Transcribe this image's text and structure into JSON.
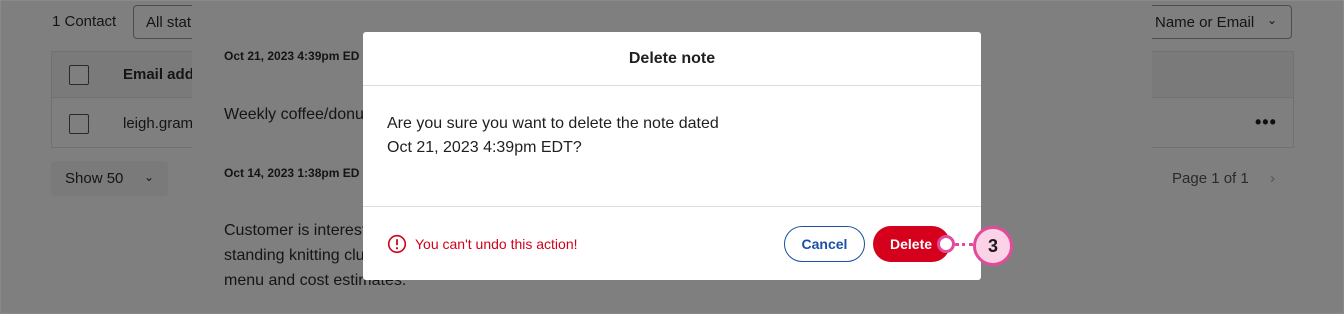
{
  "background": {
    "contact_count": "1 Contact",
    "status_filter": "All stat",
    "search_select": "Name or Email",
    "table": {
      "header_email": "Email addr",
      "row_email": "leigh.gram",
      "row_actions": "•••"
    },
    "show_select": "Show 50",
    "pagination": "Page 1 of 1"
  },
  "notes": [
    {
      "date": "Oct 21, 2023 4:39pm ED",
      "text": "Weekly coffee/donu"
    },
    {
      "date": "Oct 14, 2023 1:38pm ED",
      "text_lines": [
        "Customer is interest",
        "standing knitting clu",
        "menu and cost estimates."
      ]
    }
  ],
  "modal": {
    "title": "Delete note",
    "message_line1": "Are you sure you want to delete the note dated",
    "message_line2": "Oct 21, 2023 4:39pm EDT?",
    "warning": "You can't undo this action!",
    "cancel_label": "Cancel",
    "delete_label": "Delete"
  },
  "callout": {
    "number": "3"
  },
  "colors": {
    "danger": "#d5001c",
    "primary": "#1b50a5",
    "callout": "#e44a9c",
    "callout_fill": "#fbd3e6"
  },
  "icons": {
    "warning": "exclamation-circle-icon",
    "chevron": "chevron-down-icon",
    "more": "more-horizontal-icon"
  }
}
